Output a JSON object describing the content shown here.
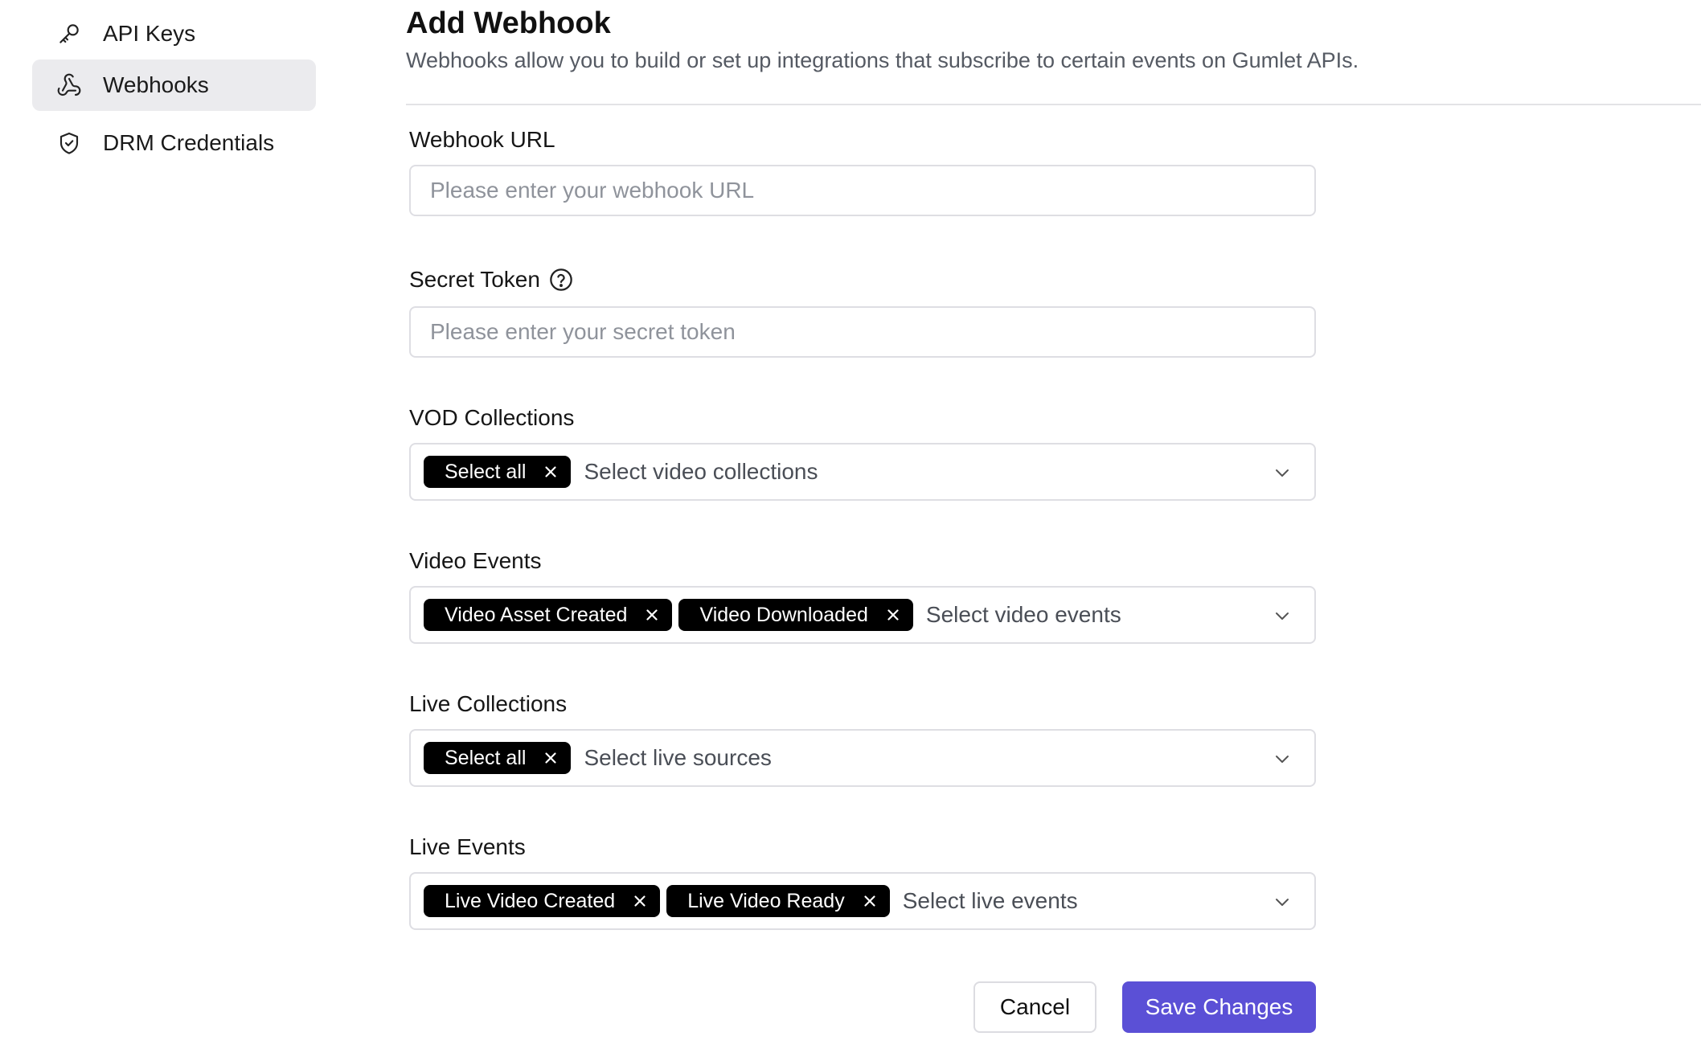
{
  "sidebar": {
    "items": [
      {
        "label": "API Keys",
        "icon": "key-icon",
        "active": false
      },
      {
        "label": "Webhooks",
        "icon": "webhook-icon",
        "active": true
      },
      {
        "label": "DRM Credentials",
        "icon": "shield-check-icon",
        "active": false
      }
    ]
  },
  "header": {
    "title": "Add Webhook",
    "subtitle": "Webhooks allow you to build or set up integrations that subscribe to certain events on Gumlet APIs."
  },
  "form": {
    "webhook_url": {
      "label": "Webhook URL",
      "value": "",
      "placeholder": "Please enter your webhook URL"
    },
    "secret_token": {
      "label": "Secret Token",
      "value": "",
      "placeholder": "Please enter your secret token",
      "help_icon": "question-circle-icon"
    },
    "vod_collections": {
      "label": "VOD Collections",
      "tags": [
        "Select all"
      ],
      "placeholder": "Select video collections"
    },
    "video_events": {
      "label": "Video Events",
      "tags": [
        "Video Asset Created",
        "Video Downloaded"
      ],
      "placeholder": "Select video events"
    },
    "live_collections": {
      "label": "Live Collections",
      "tags": [
        "Select all"
      ],
      "placeholder": "Select live sources"
    },
    "live_events": {
      "label": "Live Events",
      "tags": [
        "Live Video Created",
        "Live Video Ready"
      ],
      "placeholder": "Select live events"
    }
  },
  "actions": {
    "cancel_label": "Cancel",
    "save_label": "Save Changes"
  },
  "colors": {
    "accent": "#5b50d6",
    "tag_bg": "#000000",
    "active_nav_bg": "#ebebee",
    "border": "#dedee3"
  }
}
